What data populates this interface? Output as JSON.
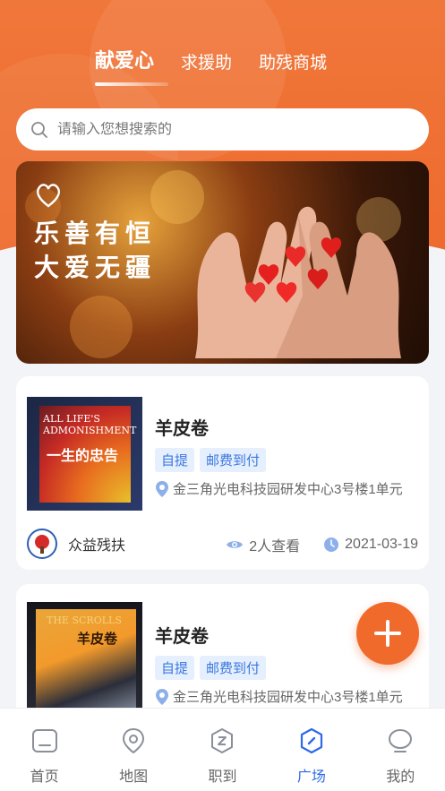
{
  "header": {
    "tabs": [
      {
        "label": "献爱心",
        "active": true
      },
      {
        "label": "求援助",
        "active": false
      },
      {
        "label": "助残商城",
        "active": false
      }
    ],
    "accent_color": "#ef6f31"
  },
  "search": {
    "placeholder": "请输入您想搜索的",
    "icon": "search-icon"
  },
  "banner": {
    "line1": "乐善有恒",
    "line2": "大爱无疆"
  },
  "cards": [
    {
      "title": "羊皮卷",
      "tags": [
        "自提",
        "邮费到付"
      ],
      "address": "金三角光电科技园研发中心3号楼1单元",
      "book_text_en": "ALL LIFE'S ADMONISHMENT",
      "book_text_cn": "一生的忠告",
      "publisher": "众益残扶",
      "views": "2人查看",
      "date": "2021-03-19"
    },
    {
      "title": "羊皮卷",
      "tags": [
        "自提",
        "邮费到付"
      ],
      "address": "金三角光电科技园研发中心3号楼1单元",
      "book_text_en": "THE SCROLLS",
      "book_text_cn": "羊皮卷"
    }
  ],
  "fab": {
    "icon": "plus-icon"
  },
  "nav": [
    {
      "label": "首页",
      "icon": "home-icon",
      "active": false
    },
    {
      "label": "地图",
      "icon": "map-pin-icon",
      "active": false
    },
    {
      "label": "职到",
      "icon": "job-icon",
      "active": false
    },
    {
      "label": "广场",
      "icon": "compass-icon",
      "active": true
    },
    {
      "label": "我的",
      "icon": "profile-icon",
      "active": false
    }
  ]
}
